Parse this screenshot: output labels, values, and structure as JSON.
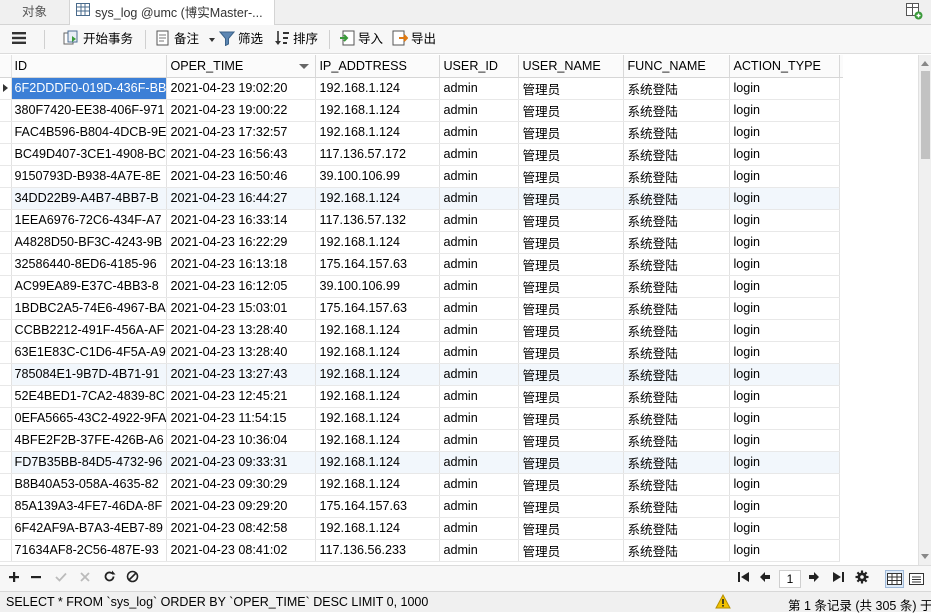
{
  "tabs": {
    "objects": "对象",
    "query": "sys_log @umc (博实Master-..."
  },
  "toolbar": {
    "begin_transaction": "开始事务",
    "note": "备注",
    "filter": "筛选",
    "sort": "排序",
    "import": "导入",
    "export": "导出"
  },
  "grid": {
    "columns": [
      {
        "key": "id",
        "label": "ID"
      },
      {
        "key": "oper_time",
        "label": "OPER_TIME"
      },
      {
        "key": "ip",
        "label": "IP_ADDTRESS"
      },
      {
        "key": "user_id",
        "label": "USER_ID"
      },
      {
        "key": "user_name",
        "label": "USER_NAME"
      },
      {
        "key": "func_name",
        "label": "FUNC_NAME"
      },
      {
        "key": "action_type",
        "label": "ACTION_TYPE"
      }
    ],
    "sorted_column": "OPER_TIME",
    "sort_direction": "desc",
    "rows": [
      [
        "6F2DDDF0-019D-436F-BB",
        "2021-04-23 19:02:20",
        "192.168.1.124",
        "admin",
        "管理员",
        "系统登陆",
        "login"
      ],
      [
        "380F7420-EE38-406F-971",
        "2021-04-23 19:00:22",
        "192.168.1.124",
        "admin",
        "管理员",
        "系统登陆",
        "login"
      ],
      [
        "FAC4B596-B804-4DCB-9E",
        "2021-04-23 17:32:57",
        "192.168.1.124",
        "admin",
        "管理员",
        "系统登陆",
        "login"
      ],
      [
        "BC49D407-3CE1-4908-BC",
        "2021-04-23 16:56:43",
        "117.136.57.172",
        "admin",
        "管理员",
        "系统登陆",
        "login"
      ],
      [
        "9150793D-B938-4A7E-8E",
        "2021-04-23 16:50:46",
        "39.100.106.99",
        "admin",
        "管理员",
        "系统登陆",
        "login"
      ],
      [
        "34DD22B9-A4B7-4BB7-B",
        "2021-04-23 16:44:27",
        "192.168.1.124",
        "admin",
        "管理员",
        "系统登陆",
        "login"
      ],
      [
        "1EEA6976-72C6-434F-A7",
        "2021-04-23 16:33:14",
        "117.136.57.132",
        "admin",
        "管理员",
        "系统登陆",
        "login"
      ],
      [
        "A4828D50-BF3C-4243-9B",
        "2021-04-23 16:22:29",
        "192.168.1.124",
        "admin",
        "管理员",
        "系统登陆",
        "login"
      ],
      [
        "32586440-8ED6-4185-96",
        "2021-04-23 16:13:18",
        "175.164.157.63",
        "admin",
        "管理员",
        "系统登陆",
        "login"
      ],
      [
        "AC99EA89-E37C-4BB3-8",
        "2021-04-23 16:12:05",
        "39.100.106.99",
        "admin",
        "管理员",
        "系统登陆",
        "login"
      ],
      [
        "1BDBC2A5-74E6-4967-BA",
        "2021-04-23 15:03:01",
        "175.164.157.63",
        "admin",
        "管理员",
        "系统登陆",
        "login"
      ],
      [
        "CCBB2212-491F-456A-AF",
        "2021-04-23 13:28:40",
        "192.168.1.124",
        "admin",
        "管理员",
        "系统登陆",
        "login"
      ],
      [
        "63E1E83C-C1D6-4F5A-A9",
        "2021-04-23 13:28:40",
        "192.168.1.124",
        "admin",
        "管理员",
        "系统登陆",
        "login"
      ],
      [
        "785084E1-9B7D-4B71-91",
        "2021-04-23 13:27:43",
        "192.168.1.124",
        "admin",
        "管理员",
        "系统登陆",
        "login"
      ],
      [
        "52E4BED1-7CA2-4839-8C",
        "2021-04-23 12:45:21",
        "192.168.1.124",
        "admin",
        "管理员",
        "系统登陆",
        "login"
      ],
      [
        "0EFA5665-43C2-4922-9FA",
        "2021-04-23 11:54:15",
        "192.168.1.124",
        "admin",
        "管理员",
        "系统登陆",
        "login"
      ],
      [
        "4BFE2F2B-37FE-426B-A6",
        "2021-04-23 10:36:04",
        "192.168.1.124",
        "admin",
        "管理员",
        "系统登陆",
        "login"
      ],
      [
        "FD7B35BB-84D5-4732-96",
        "2021-04-23 09:33:31",
        "192.168.1.124",
        "admin",
        "管理员",
        "系统登陆",
        "login"
      ],
      [
        "B8B40A53-058A-4635-82",
        "2021-04-23 09:30:29",
        "192.168.1.124",
        "admin",
        "管理员",
        "系统登陆",
        "login"
      ],
      [
        "85A139A3-4FE7-46DA-8F",
        "2021-04-23 09:29:20",
        "175.164.157.63",
        "admin",
        "管理员",
        "系统登陆",
        "login"
      ],
      [
        "6F42AF9A-B7A3-4EB7-89",
        "2021-04-23 08:42:58",
        "192.168.1.124",
        "admin",
        "管理员",
        "系统登陆",
        "login"
      ],
      [
        "71634AF8-2C56-487E-93",
        "2021-04-23 08:41:02",
        "117.136.56.233",
        "admin",
        "管理员",
        "系统登陆",
        "login"
      ]
    ]
  },
  "nav": {
    "page_number": "1"
  },
  "status": {
    "sql": "SELECT * FROM `sys_log` ORDER BY `OPER_TIME` DESC LIMIT 0, 1000",
    "record_info": "第 1 条记录 (共 305 条) 于"
  },
  "colors": {
    "selection": "#3c7fd6",
    "row_highlight": "#f2f7fc"
  }
}
